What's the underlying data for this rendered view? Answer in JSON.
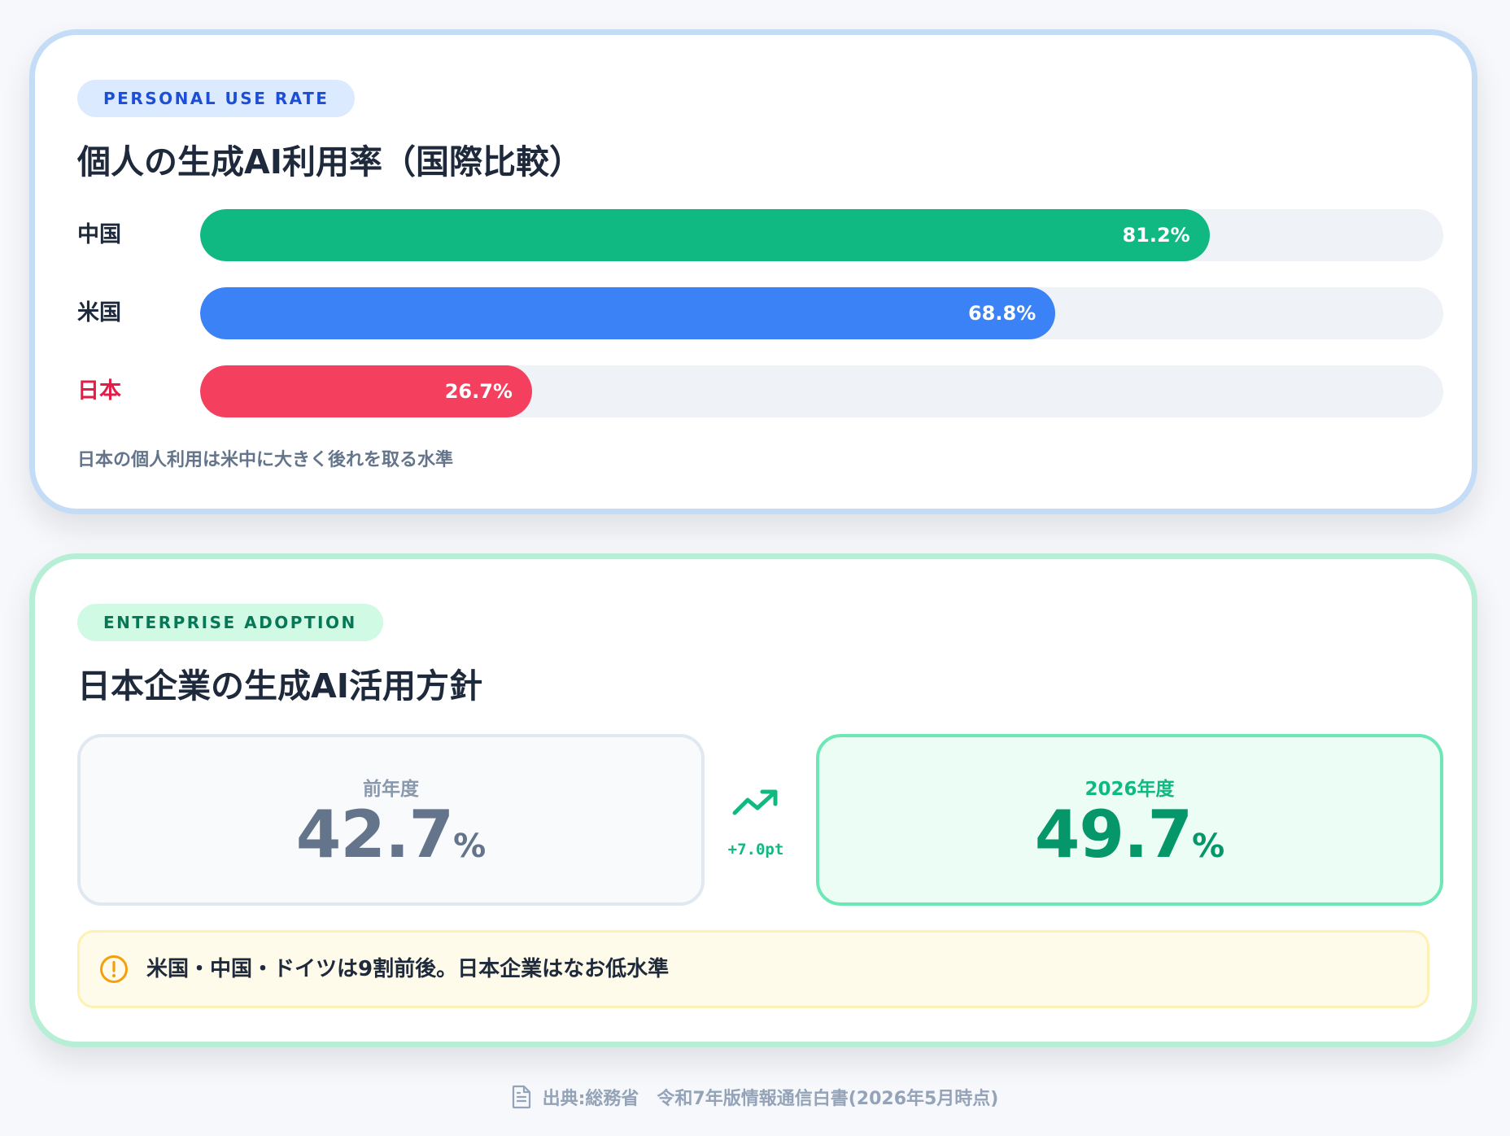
{
  "personal": {
    "badge": "PERSONAL USE RATE",
    "title": "個人の生成AI利用率（国際比較）",
    "note": "日本の個人利用は米中に大きく後れを取る水準"
  },
  "enterprise": {
    "badge": "ENTERPRISE ADOPTION",
    "title": "日本企業の生成AI活用方針",
    "prev_label": "前年度",
    "prev_value": "42.7",
    "curr_label": "2026年度",
    "curr_value": "49.7",
    "unit": "%",
    "delta": "+7.0pt",
    "notice": "米国・中国・ドイツは9割前後。日本企業はなお低水準"
  },
  "footer": {
    "source": "出典:総務省　令和7年版情報通信白書(2026年5月時点)"
  },
  "chart_data": [
    {
      "type": "bar",
      "orientation": "horizontal",
      "title": "個人の生成AI利用率（国際比較）",
      "categories": [
        "中国",
        "米国",
        "日本"
      ],
      "values": [
        81.2,
        68.8,
        26.7
      ],
      "value_labels": [
        "81.2%",
        "68.8%",
        "26.7%"
      ],
      "xlim": [
        0,
        100
      ],
      "colors": [
        "#10b981",
        "#3b82f6",
        "#f43f5e"
      ],
      "label_colors": [
        "#1e293b",
        "#1e293b",
        "#e11d48"
      ]
    },
    {
      "type": "bar",
      "title": "日本企業の生成AI活用方針",
      "categories": [
        "前年度",
        "2026年度"
      ],
      "values": [
        42.7,
        49.7
      ],
      "change": "+7.0pt",
      "colors": [
        "#64748b",
        "#059669"
      ]
    }
  ]
}
